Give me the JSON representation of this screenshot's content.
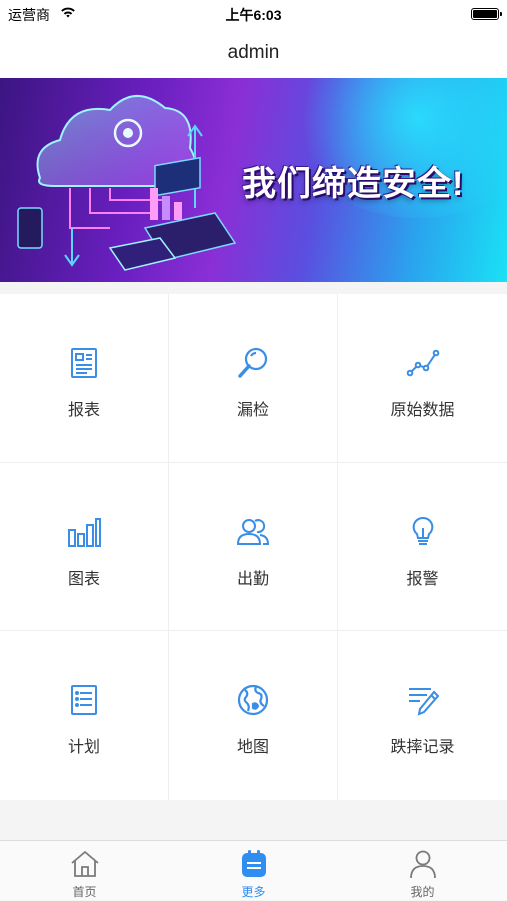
{
  "status_bar": {
    "carrier": "运营商",
    "time": "上午6:03",
    "battery_percent": 100
  },
  "nav": {
    "title": "admin"
  },
  "banner": {
    "slogan": "我们缔造安全!",
    "pages": 3,
    "active_page": 1
  },
  "menu": [
    {
      "label": "报表",
      "icon": "report-icon"
    },
    {
      "label": "漏检",
      "icon": "magnifier-icon"
    },
    {
      "label": "原始数据",
      "icon": "line-chart-icon"
    },
    {
      "label": "图表",
      "icon": "bar-chart-icon"
    },
    {
      "label": "出勤",
      "icon": "people-icon"
    },
    {
      "label": "报警",
      "icon": "lightbulb-icon"
    },
    {
      "label": "计划",
      "icon": "list-icon"
    },
    {
      "label": "地图",
      "icon": "globe-icon"
    },
    {
      "label": "跌摔记录",
      "icon": "edit-note-icon"
    }
  ],
  "tabbar": {
    "active": 1,
    "items": [
      {
        "label": "首页",
        "icon": "home-icon"
      },
      {
        "label": "更多",
        "icon": "more-icon"
      },
      {
        "label": "我的",
        "icon": "user-icon"
      }
    ]
  },
  "colors": {
    "accent": "#2f8ef0",
    "icon_blue": "#3a8ee6",
    "grid_bg": "#ffffff",
    "page_bg": "#f4f4f5"
  }
}
